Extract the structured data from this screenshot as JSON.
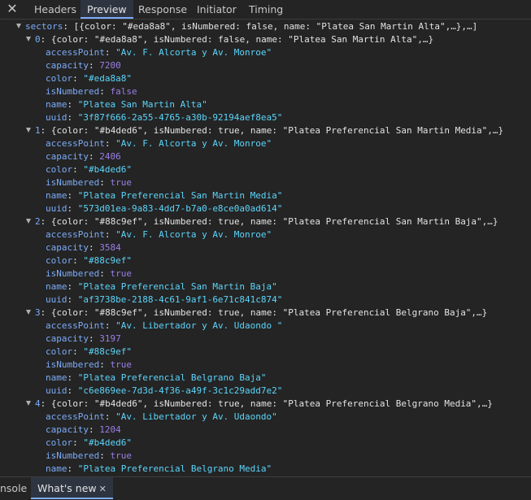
{
  "tabs": {
    "close_icon": "✕",
    "items": [
      "Headers",
      "Preview",
      "Response",
      "Initiator",
      "Timing"
    ],
    "active": "Preview"
  },
  "tree": {
    "root_key": "sectors",
    "root_summary": "[{color: \"#eda8a8\", isNumbered: false, name: \"Platea San Martin Alta\",…},…]",
    "sectors": [
      {
        "index": "0",
        "summary": "{color: \"#eda8a8\", isNumbered: false, name: \"Platea San Martin Alta\",…}",
        "accessPoint": "\"Av. F. Alcorta y Av. Monroe\"",
        "capacity": "7200",
        "color": "\"#eda8a8\"",
        "isNumbered": "false",
        "name": "\"Platea San Martin Alta\"",
        "uuid": "\"3f87f666-2a55-4765-a30b-92194aef8ea5\""
      },
      {
        "index": "1",
        "summary": "{color: \"#b4ded6\", isNumbered: true, name: \"Platea Preferencial San Martin Media\",…}",
        "accessPoint": "\"Av. F. Alcorta y Av. Monroe\"",
        "capacity": "2406",
        "color": "\"#b4ded6\"",
        "isNumbered": "true",
        "name": "\"Platea Preferencial San Martin Media\"",
        "uuid": "\"573d01ea-9a83-4dd7-b7a0-e8ce0a0ad614\""
      },
      {
        "index": "2",
        "summary": "{color: \"#88c9ef\", isNumbered: true, name: \"Platea Preferencial San Martin Baja\",…}",
        "accessPoint": "\"Av. F. Alcorta y Av. Monroe\"",
        "capacity": "3584",
        "color": "\"#88c9ef\"",
        "isNumbered": "true",
        "name": "\"Platea Preferencial San Martin Baja\"",
        "uuid": "\"af3738be-2188-4c61-9af1-6e71c841c874\""
      },
      {
        "index": "3",
        "summary": "{color: \"#88c9ef\", isNumbered: true, name: \"Platea Preferencial Belgrano Baja\",…}",
        "accessPoint": "\"Av. Libertador y Av. Udaondo \"",
        "capacity": "3197",
        "color": "\"#88c9ef\"",
        "isNumbered": "true",
        "name": "\"Platea Preferencial Belgrano Baja\"",
        "uuid": "\"c6e869ee-7d3d-4f36-a49f-3c1c29add7e2\""
      },
      {
        "index": "4",
        "summary": "{color: \"#b4ded6\", isNumbered: true, name: \"Platea Preferencial Belgrano Media\",…}",
        "accessPoint": "\"Av. Libertador y Av. Udaondo\"",
        "capacity": "1204",
        "color": "\"#b4ded6\"",
        "isNumbered": "true",
        "name": "\"Platea Preferencial Belgrano Media\""
      }
    ]
  },
  "drawer": {
    "console_label": "nsole",
    "whats_new_label": "What's new",
    "close_icon": "✕"
  },
  "colors": {
    "background": "#242424",
    "key": "#7cacf8",
    "string": "#5cd5fb",
    "number": "#9b7fe6",
    "active_tab_underline": "#7cacf8"
  }
}
